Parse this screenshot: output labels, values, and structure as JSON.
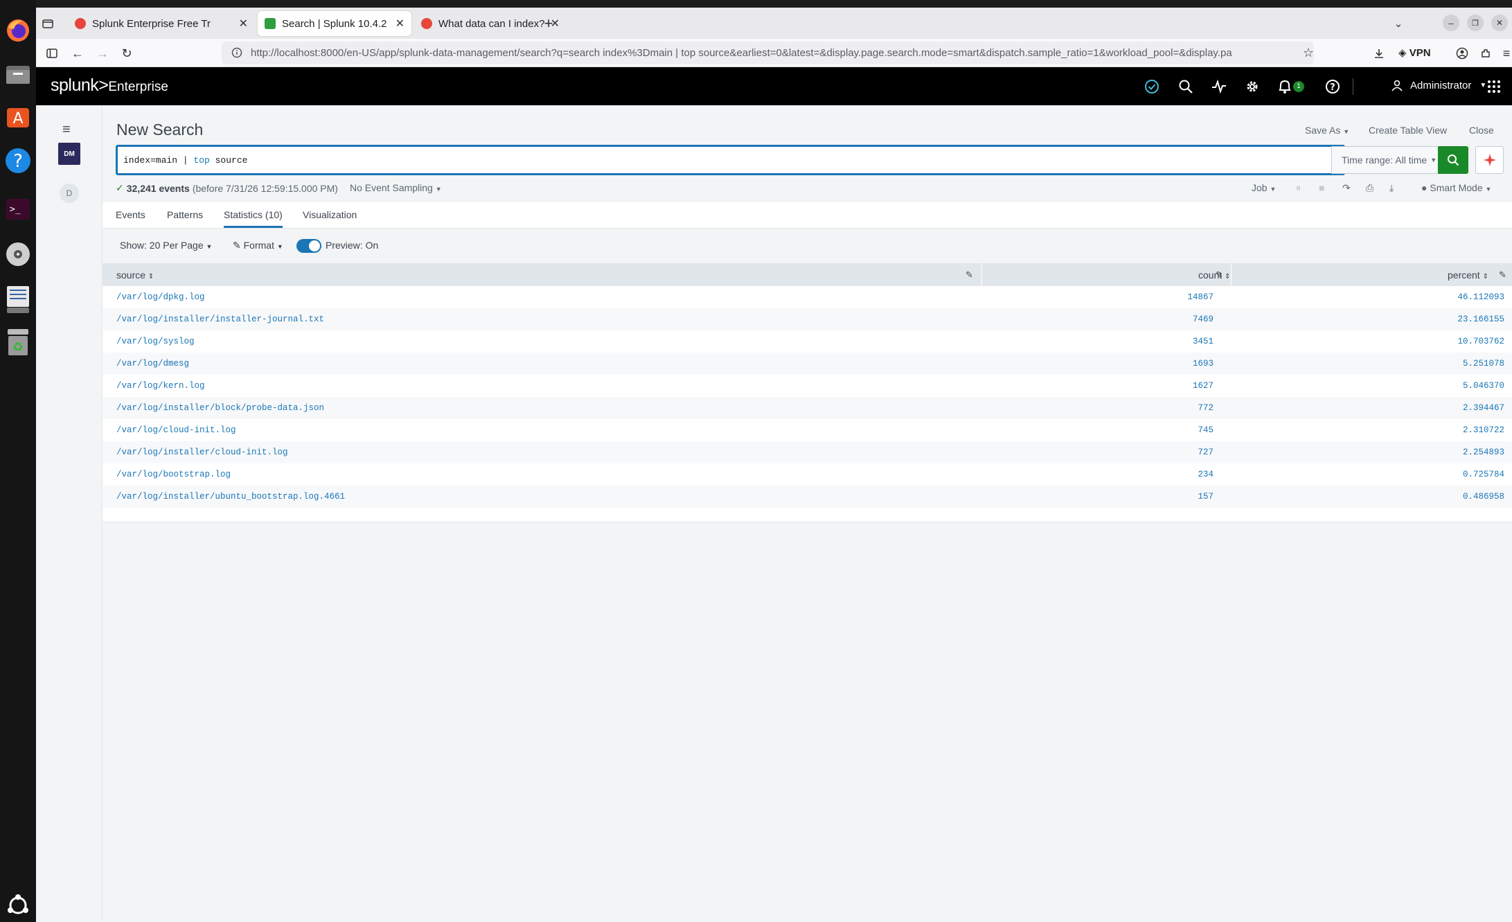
{
  "browser": {
    "tabs": [
      {
        "title": "Splunk Enterprise Free Tr",
        "icon": "splunk-red-icon"
      },
      {
        "title": "Search | Splunk 10.4.2",
        "icon": "splunk-green-icon"
      },
      {
        "title": "What data can I index? | S",
        "icon": "splunk-red-icon"
      }
    ],
    "url": "http://localhost:8000/en-US/app/splunk-data-management/search?q=search index%3Dmain | top source&earliest=0&latest=&display.page.search.mode=smart&dispatch.sample_ratio=1&workload_pool=&display.pa",
    "vpn_label": "VPN"
  },
  "splunk": {
    "logo": "splunk>",
    "product": "Enterprise",
    "notification_count": "1",
    "user": "Administrator",
    "app_badge": "DM",
    "app_nav_letter": "D"
  },
  "search": {
    "title": "New Search",
    "save_as": "Save As",
    "create_table_view": "Create Table View",
    "close": "Close",
    "query_prefix": "index=main | ",
    "query_command": "top",
    "query_suffix": " source",
    "time_range": "Time range: All time",
    "event_count": "32,241 events",
    "event_window": "(before 7/31/26 12:59:15.000 PM)",
    "sampling": "No Event Sampling",
    "job": "Job",
    "mode": "Smart Mode"
  },
  "view_tabs": [
    {
      "label": "Events"
    },
    {
      "label": "Patterns"
    },
    {
      "label": "Statistics (10)"
    },
    {
      "label": "Visualization"
    }
  ],
  "controls": {
    "per_page": "Show: 20 Per Page",
    "format": "Format",
    "preview": "Preview: On"
  },
  "table": {
    "headers": {
      "source": "source",
      "count": "count",
      "percent": "percent"
    },
    "rows": [
      {
        "source": "/var/log/dpkg.log",
        "count": "14867",
        "percent": "46.112093"
      },
      {
        "source": "/var/log/installer/installer-journal.txt",
        "count": "7469",
        "percent": "23.166155"
      },
      {
        "source": "/var/log/syslog",
        "count": "3451",
        "percent": "10.703762"
      },
      {
        "source": "/var/log/dmesg",
        "count": "1693",
        "percent": "5.251078"
      },
      {
        "source": "/var/log/kern.log",
        "count": "1627",
        "percent": "5.046370"
      },
      {
        "source": "/var/log/installer/block/probe-data.json",
        "count": "772",
        "percent": "2.394467"
      },
      {
        "source": "/var/log/cloud-init.log",
        "count": "745",
        "percent": "2.310722"
      },
      {
        "source": "/var/log/installer/cloud-init.log",
        "count": "727",
        "percent": "2.254893"
      },
      {
        "source": "/var/log/bootstrap.log",
        "count": "234",
        "percent": "0.725784"
      },
      {
        "source": "/var/log/installer/ubuntu_bootstrap.log.4661",
        "count": "157",
        "percent": "0.486958"
      }
    ]
  },
  "colors": {
    "accent": "#1a76b6",
    "search_button": "#1a8929",
    "splunk_header": "#000000",
    "app_badge": "#2c2a5c"
  }
}
